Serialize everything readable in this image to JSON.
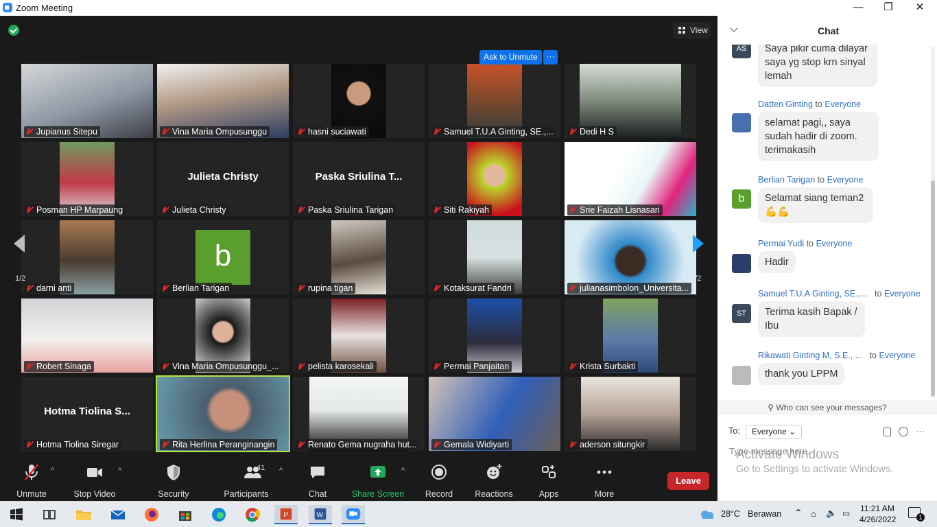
{
  "window": {
    "title": "Zoom Meeting",
    "min": "—",
    "max": "❐",
    "close": "✕"
  },
  "view_label": "View",
  "ask_to_unmute": "Ask to Unmute",
  "ask_more": "···",
  "pager": {
    "left": "1/2",
    "right": "1/2"
  },
  "tiles": [
    {
      "name": "Jupianus Sitepu"
    },
    {
      "name": "Vina Maria Ompusunggu"
    },
    {
      "name": "hasni suciawati"
    },
    {
      "name": "Samuel T.U.A Ginting, SE.,..."
    },
    {
      "name": "Dedi H S"
    },
    {
      "name": "Posman HP Marpaung"
    },
    {
      "name": "Julieta Christy",
      "big": "Julieta Christy"
    },
    {
      "name": "Paska Sriulina Tarigan",
      "big": "Paska Sriulina T..."
    },
    {
      "name": "Siti Rakiyah"
    },
    {
      "name": "Srie Faizah Lisnasari"
    },
    {
      "name": "darni anti"
    },
    {
      "name": "Berlian Tarigan",
      "letter": "b"
    },
    {
      "name": "rupina tigan"
    },
    {
      "name": "Kotaksurat Fandri"
    },
    {
      "name": "julianasimbolon_Universita..."
    },
    {
      "name": "Robert Sinaga"
    },
    {
      "name": "Vina Maria Ompusunggu_..."
    },
    {
      "name": "pelista karosekali"
    },
    {
      "name": "Permai Panjaitan"
    },
    {
      "name": "Krista Surbakti"
    },
    {
      "name": "Hotma Tiolina Siregar",
      "big": "Hotma Tiolina S..."
    },
    {
      "name": "Rita Herlina Peranginangin"
    },
    {
      "name": "Renato Gema nugraha hut..."
    },
    {
      "name": "Gemala Widiyarti"
    },
    {
      "name": "aderson situngkir"
    }
  ],
  "toolbar": {
    "unmute": "Unmute",
    "stop_video": "Stop Video",
    "security": "Security",
    "participants": "Participants",
    "participants_count": "41",
    "chat": "Chat",
    "share_screen": "Share Screen",
    "record": "Record",
    "reactions": "Reactions",
    "apps": "Apps",
    "more": "More",
    "leave": "Leave",
    "caret": "^"
  },
  "chat": {
    "title": "Chat",
    "messages": [
      {
        "initials": "AS",
        "text": "Saya pikir cuma dilayar saya yg stop krn sinyal lemah"
      },
      {
        "sender": "Datten Ginting",
        "to": "to",
        "recipient": "Everyone",
        "text": "selamat pagi,, saya sudah hadir di zoom. terimakasih"
      },
      {
        "sender": "Berlian Tarigan",
        "to": "to",
        "recipient": "Everyone",
        "initials": "b",
        "text": "Selamat siang teman2 💪💪"
      },
      {
        "sender": "Permai Yudi",
        "to": "to",
        "recipient": "Everyone",
        "text": "Hadir"
      },
      {
        "sender": "Samuel T.U.A Ginting, SE.,...",
        "to": "to",
        "recipient": "Everyone",
        "initials": "ST",
        "text": "Terima kasih Bapak / Ibu"
      },
      {
        "sender": "Rikawati Ginting M, S.E., ...",
        "to": "to",
        "recipient": "Everyone",
        "text": "thank you LPPM"
      }
    ],
    "who_can_see": "Who can see your messages?",
    "to_label": "To:",
    "to_value": "Everyone",
    "input_placeholder": "Type message here..."
  },
  "watermark": {
    "line1": "Activate Windows",
    "line2": "Go to Settings to activate Windows."
  },
  "taskbar": {
    "weather": "28°C",
    "weather_text": "Berawan",
    "time": "11:21 AM",
    "date": "4/26/2022",
    "notifications": "1"
  },
  "colors": {
    "accent": "#0e72ed",
    "leave": "#c8272a",
    "active_speaker": "#b6e33a",
    "share": "#23a85c"
  }
}
